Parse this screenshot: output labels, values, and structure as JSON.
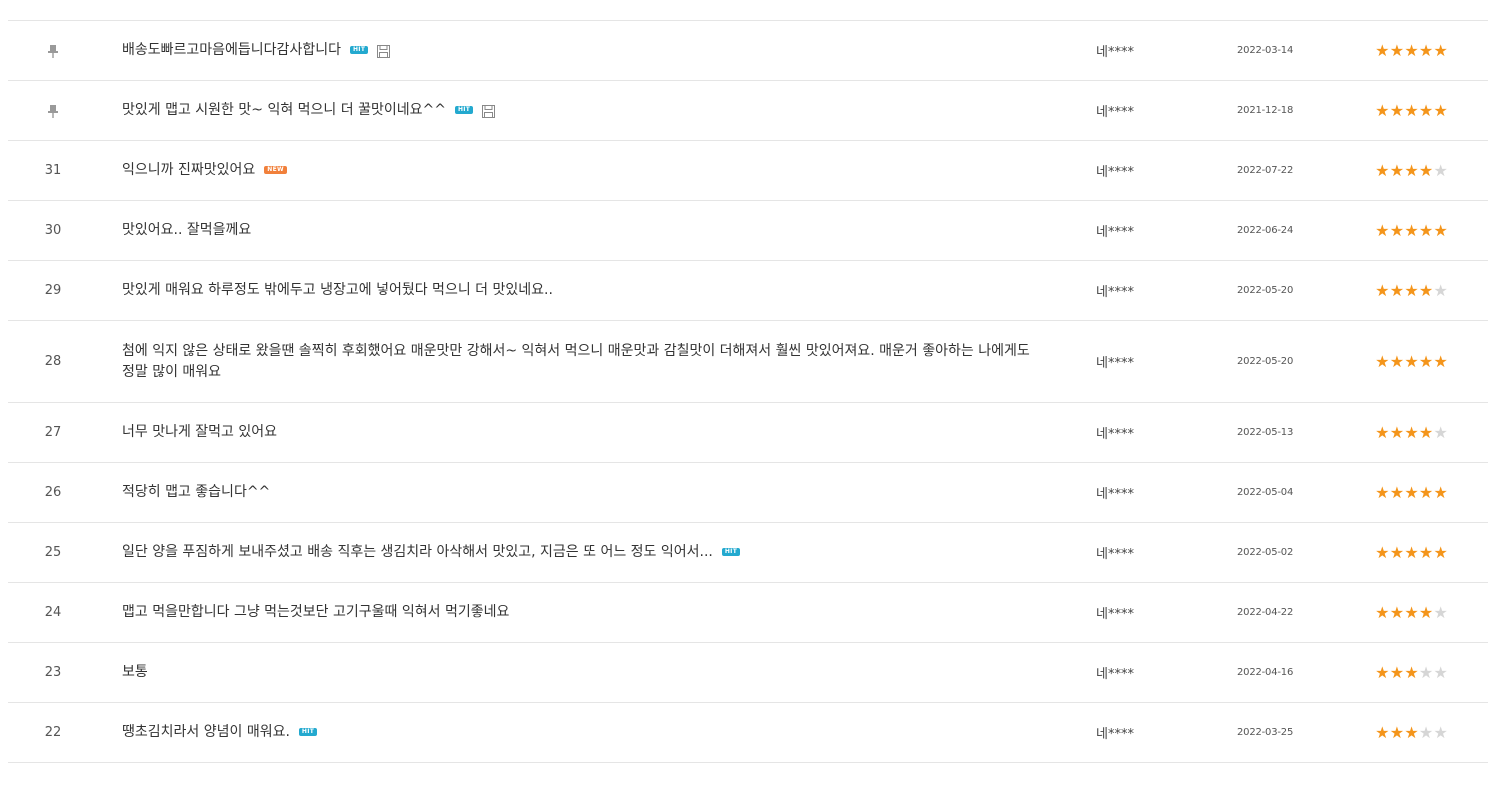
{
  "colors": {
    "star_on": "#f4951b",
    "star_off": "#d6d6d6",
    "hit_badge": "#23a9cf",
    "new_badge": "#f1803b",
    "divider": "#e5e5e5"
  },
  "badges": {
    "hit": "HIT",
    "new": "NEW"
  },
  "icons": {
    "notice": "pin-icon",
    "attachment": "floppy-disk-icon",
    "star": "star-icon"
  },
  "reviews": [
    {
      "notice": true,
      "no": "",
      "subject": "배송도빠르고마음에듭니다감사합니다",
      "hit": true,
      "new": false,
      "file": true,
      "writer": "네****",
      "date": "2022-03-14",
      "rating": 5
    },
    {
      "notice": true,
      "no": "",
      "subject": "맛있게 맵고 시원한 맛~ 익혀 먹으니 더 꿀맛이네요^^",
      "hit": true,
      "new": false,
      "file": true,
      "writer": "네****",
      "date": "2021-12-18",
      "rating": 5
    },
    {
      "notice": false,
      "no": "31",
      "subject": "익으니까 진짜맛있어요",
      "hit": false,
      "new": true,
      "file": false,
      "writer": "네****",
      "date": "2022-07-22",
      "rating": 4
    },
    {
      "notice": false,
      "no": "30",
      "subject": "맛있어요.. 잘먹을께요",
      "hit": false,
      "new": false,
      "file": false,
      "writer": "네****",
      "date": "2022-06-24",
      "rating": 5
    },
    {
      "notice": false,
      "no": "29",
      "subject": "맛있게 매워요 하루정도 밖에두고 냉장고에 넣어뒀다 먹으니 더 맛있네요..",
      "hit": false,
      "new": false,
      "file": false,
      "writer": "네****",
      "date": "2022-05-20",
      "rating": 4
    },
    {
      "notice": false,
      "no": "28",
      "subject": "첨에 익지 않은 상태로 왔을땐 솔찍히 후회했어요 매운맛만 강해서~ 익혀서 먹으니 매운맛과 감칠맛이 더해져서 훨씬 맛있어져요. 매운거 좋아하는 나에게도 정말 많이 매워요",
      "hit": false,
      "new": false,
      "file": false,
      "writer": "네****",
      "date": "2022-05-20",
      "rating": 5,
      "tall": true
    },
    {
      "notice": false,
      "no": "27",
      "subject": "너무 맛나게 잘먹고 있어요",
      "hit": false,
      "new": false,
      "file": false,
      "writer": "네****",
      "date": "2022-05-13",
      "rating": 4
    },
    {
      "notice": false,
      "no": "26",
      "subject": "적당히 맵고 좋습니다^^",
      "hit": false,
      "new": false,
      "file": false,
      "writer": "네****",
      "date": "2022-05-04",
      "rating": 5
    },
    {
      "notice": false,
      "no": "25",
      "subject": "일단 양을 푸짐하게 보내주셨고 배송 직후는 생김치라 아삭해서 맛있고, 지금은 또 어느 정도 익어서...",
      "hit": true,
      "new": false,
      "file": false,
      "writer": "네****",
      "date": "2022-05-02",
      "rating": 5
    },
    {
      "notice": false,
      "no": "24",
      "subject": "맵고 먹을만합니다 그냥 먹는것보단 고기구울때 익혀서 먹기좋네요",
      "hit": false,
      "new": false,
      "file": false,
      "writer": "네****",
      "date": "2022-04-22",
      "rating": 4
    },
    {
      "notice": false,
      "no": "23",
      "subject": "보통",
      "hit": false,
      "new": false,
      "file": false,
      "writer": "네****",
      "date": "2022-04-16",
      "rating": 3
    },
    {
      "notice": false,
      "no": "22",
      "subject": "땡초김치라서 양념이 매워요.",
      "hit": true,
      "new": false,
      "file": false,
      "writer": "네****",
      "date": "2022-03-25",
      "rating": 3
    }
  ]
}
